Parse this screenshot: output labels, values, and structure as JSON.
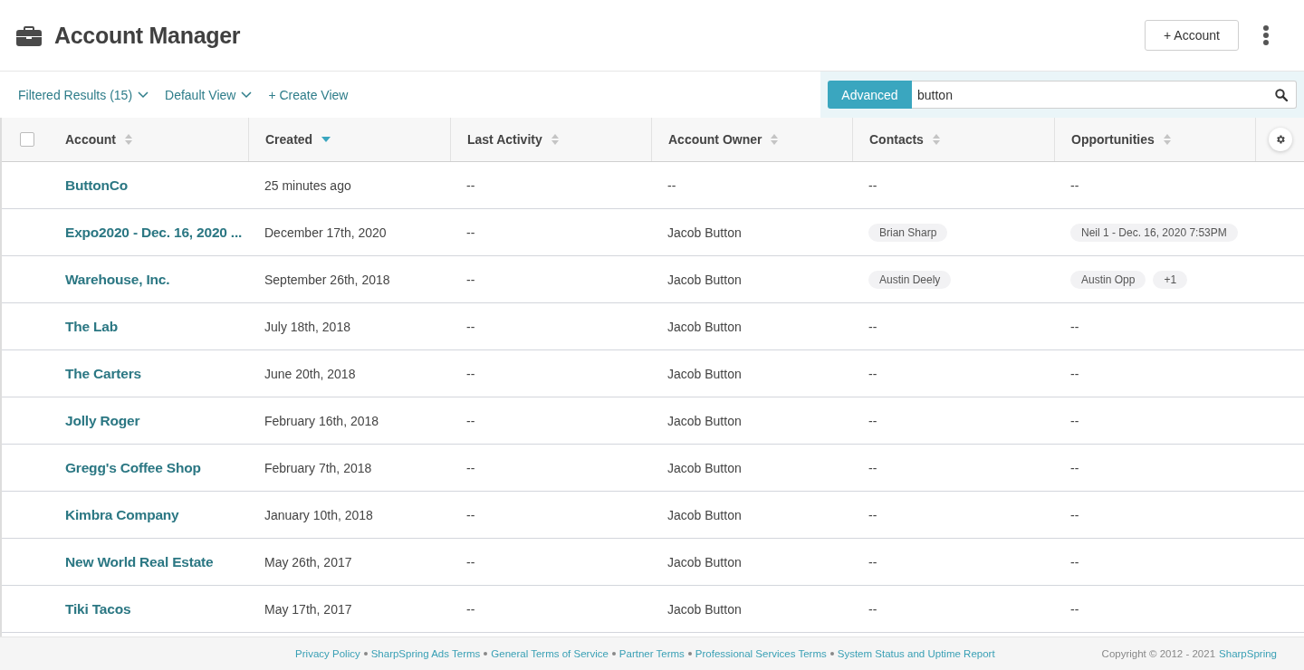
{
  "header": {
    "title": "Account Manager",
    "add_button": "+ Account"
  },
  "toolbar": {
    "filter": "Filtered Results  (15)",
    "view": "Default View",
    "create_view": "+ Create View",
    "search_mode": "Advanced",
    "search_value": "button"
  },
  "table": {
    "select_all_checked": false,
    "columns": [
      {
        "label": "Account",
        "sorted": false
      },
      {
        "label": "Created",
        "sorted": true
      },
      {
        "label": "Last Activity",
        "sorted": false
      },
      {
        "label": "Account Owner",
        "sorted": false
      },
      {
        "label": "Contacts",
        "sorted": false
      },
      {
        "label": "Opportunities",
        "sorted": false
      }
    ],
    "rows": [
      {
        "account": "ButtonCo",
        "created": "25 minutes ago",
        "last_activity": "--",
        "owner": "--",
        "contacts": "--",
        "opportunities": "--"
      },
      {
        "account": "Expo2020 - Dec. 16, 2020 ...",
        "created": "December 17th, 2020",
        "last_activity": "--",
        "owner": "Jacob Button",
        "contacts": [
          "Brian Sharp"
        ],
        "opportunities": [
          "Neil 1 - Dec. 16, 2020 7:53PM"
        ]
      },
      {
        "account": "Warehouse, Inc.",
        "created": "September 26th, 2018",
        "last_activity": "--",
        "owner": "Jacob Button",
        "contacts": [
          "Austin Deely"
        ],
        "opportunities": [
          "Austin Opp",
          "+1"
        ]
      },
      {
        "account": "The Lab",
        "created": "July 18th, 2018",
        "last_activity": "--",
        "owner": "Jacob Button",
        "contacts": "--",
        "opportunities": "--"
      },
      {
        "account": "The Carters",
        "created": "June 20th, 2018",
        "last_activity": "--",
        "owner": "Jacob Button",
        "contacts": "--",
        "opportunities": "--"
      },
      {
        "account": "Jolly Roger",
        "created": "February 16th, 2018",
        "last_activity": "--",
        "owner": "Jacob Button",
        "contacts": "--",
        "opportunities": "--"
      },
      {
        "account": "Gregg's Coffee Shop",
        "created": "February 7th, 2018",
        "last_activity": "--",
        "owner": "Jacob Button",
        "contacts": "--",
        "opportunities": "--"
      },
      {
        "account": "Kimbra Company",
        "created": "January 10th, 2018",
        "last_activity": "--",
        "owner": "Jacob Button",
        "contacts": "--",
        "opportunities": "--"
      },
      {
        "account": "New World Real Estate",
        "created": "May 26th, 2017",
        "last_activity": "--",
        "owner": "Jacob Button",
        "contacts": "--",
        "opportunities": "--"
      },
      {
        "account": "Tiki Tacos",
        "created": "May 17th, 2017",
        "last_activity": "--",
        "owner": "Jacob Button",
        "contacts": "--",
        "opportunities": "--"
      }
    ]
  },
  "footer": {
    "links": [
      "Privacy Policy",
      "SharpSpring Ads Terms",
      "General Terms of Service",
      "Partner Terms",
      "Professional Services Terms",
      "System Status and Uptime Report"
    ],
    "copyright": "Copyright © 2012 - 2021",
    "copyright_link": "SharpSpring"
  }
}
